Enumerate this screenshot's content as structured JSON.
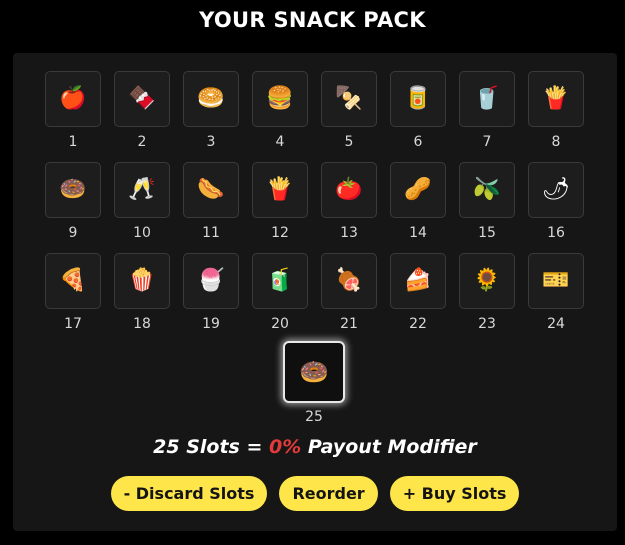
{
  "title": "YOUR SNACK PACK",
  "slots": [
    {
      "number": "1",
      "icon": "🍎",
      "icon_name": "apple-icon"
    },
    {
      "number": "2",
      "icon": "🍫",
      "icon_name": "candy-bar-icon"
    },
    {
      "number": "3",
      "icon": "🥯",
      "icon_name": "bagel-icon"
    },
    {
      "number": "4",
      "icon": "🍔",
      "icon_name": "burger-icon"
    },
    {
      "number": "5",
      "icon": "🍢",
      "icon_name": "skewer-icon"
    },
    {
      "number": "6",
      "icon": "🥫",
      "icon_name": "snack-bag-icon"
    },
    {
      "number": "7",
      "icon": "🥤",
      "icon_name": "cup-icon"
    },
    {
      "number": "8",
      "icon": "🍟",
      "icon_name": "fries-box-icon"
    },
    {
      "number": "9",
      "icon": "🍩",
      "icon_name": "pink-donut-icon"
    },
    {
      "number": "10",
      "icon": "🥂",
      "icon_name": "champagne-glass-icon"
    },
    {
      "number": "11",
      "icon": "🌭",
      "icon_name": "hot-dog-icon"
    },
    {
      "number": "12",
      "icon": "🍟",
      "icon_name": "fries-icon"
    },
    {
      "number": "13",
      "icon": "🍅",
      "icon_name": "tomato-icon"
    },
    {
      "number": "14",
      "icon": "🥜",
      "icon_name": "peanut-icon"
    },
    {
      "number": "15",
      "icon": "🫒",
      "icon_name": "green-olives-icon"
    },
    {
      "number": "16",
      "icon": "🌶",
      "icon_name": "red-candy-fish-icon"
    },
    {
      "number": "17",
      "icon": "🍕",
      "icon_name": "pizza-slice-icon"
    },
    {
      "number": "18",
      "icon": "🍿",
      "icon_name": "popcorn-icon"
    },
    {
      "number": "19",
      "icon": "🍧",
      "icon_name": "slushie-icon"
    },
    {
      "number": "20",
      "icon": "🧃",
      "icon_name": "jar-icon"
    },
    {
      "number": "21",
      "icon": "🍖",
      "icon_name": "meat-icon"
    },
    {
      "number": "22",
      "icon": "🍰",
      "icon_name": "cake-slice-icon"
    },
    {
      "number": "23",
      "icon": "🌻",
      "icon_name": "sunflower-seeds-icon"
    },
    {
      "number": "24",
      "icon": "🎫",
      "icon_name": "ticket-icon"
    }
  ],
  "selected_slot": {
    "number": "25",
    "icon": "🍩",
    "icon_name": "dark-donut-icon"
  },
  "modifier": {
    "slots_text": "25 Slots = ",
    "percent": "0%",
    "suffix": " Payout Modifier",
    "percent_color": "#e23a3a"
  },
  "buttons": {
    "discard": "- Discard Slots",
    "reorder": "Reorder",
    "buy": "+ Buy Slots"
  },
  "colors": {
    "button_bg": "#fde54a",
    "panel_bg": "#161616",
    "page_bg": "#000000"
  }
}
